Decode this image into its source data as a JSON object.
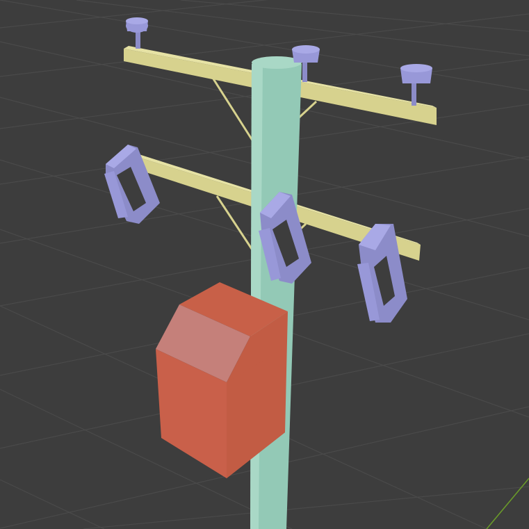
{
  "viewport": {
    "kind": "3d-viewport",
    "background": "#3d3d3d",
    "grid_color": "#4a4a4a",
    "axis_color": "#6a9a2a",
    "grid": true
  },
  "model": {
    "pole": {
      "color": "#93c9b6"
    },
    "crossarm": {
      "color": "#d7d28e",
      "count": 2
    },
    "pin_insulator": {
      "color": "#9898d8",
      "count": 3
    },
    "suspension_insulator": {
      "color": "#9898d8",
      "count": 3
    },
    "transformer": {
      "color": "#c86048"
    }
  }
}
